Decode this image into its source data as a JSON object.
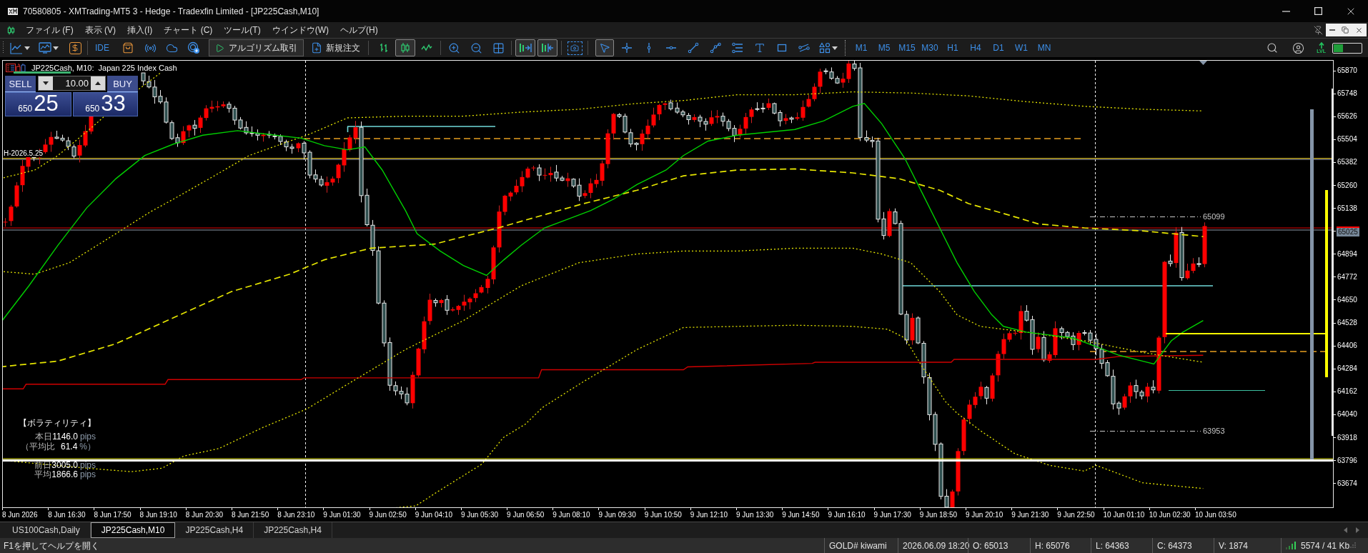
{
  "window": {
    "title": "70580805 - XMTrading-MT5 3 - Hedge - Tradexfin Limited - [JP225Cash,M10]"
  },
  "menu": [
    {
      "label": "ファイル (F)"
    },
    {
      "label": "表示 (V)"
    },
    {
      "label": "挿入(I)"
    },
    {
      "label": "チャート (C)"
    },
    {
      "label": "ツール(T)"
    },
    {
      "label": "ウインドウ(W)"
    },
    {
      "label": "ヘルプ(H)"
    }
  ],
  "toolbar": {
    "ide_label": "IDE",
    "algo_trading_label": "アルゴリズム取引",
    "new_order_label": "新規注文",
    "chart_types": [
      {
        "selected": false
      },
      {
        "selected": true
      },
      {
        "selected": false
      }
    ],
    "autoscroll": {
      "selected": true
    },
    "chart_shift": {
      "selected": true
    },
    "drawing_tools": [
      {
        "selected": true
      },
      {
        "selected": false
      },
      {
        "selected": false
      },
      {
        "selected": false
      },
      {
        "selected": false
      },
      {
        "selected": false
      },
      {
        "selected": false
      },
      {
        "selected": false
      },
      {
        "selected": false
      },
      {
        "selected": false
      },
      {
        "selected": false
      }
    ],
    "timeframes": [
      "M1",
      "M5",
      "M15",
      "M30",
      "H1",
      "H4",
      "D1",
      "W1",
      "MN"
    ],
    "level_label": "LVL",
    "meter": {
      "level": 0.33
    }
  },
  "chart": {
    "header": "JP225Cash, M10:  Japan 225 Index Cash",
    "one_click": {
      "sell_label": "SELL",
      "buy_label": "BUY",
      "volume": "10.00",
      "bid": {
        "prefix": "650",
        "main": "25"
      },
      "ask": {
        "prefix": "650",
        "main": "33"
      }
    },
    "h_line_label": "H-2026.5.25",
    "level_labels": [
      "65099",
      "63953"
    ],
    "volatility": {
      "title": "【ボラティリティ】",
      "rows": [
        {
          "label": "本日",
          "value": "1146.0",
          "unit": "pips"
        },
        {
          "label": "（平均比",
          "value": "61.4",
          "unit": "%）"
        },
        {
          "label": "前日",
          "value": "3005.0",
          "unit": "pips"
        },
        {
          "label": "平均",
          "value": "1866.6",
          "unit": "pips"
        }
      ]
    },
    "price_axis": [
      {
        "label": "65870",
        "current": false
      },
      {
        "label": "65748",
        "current": false
      },
      {
        "label": "65626",
        "current": false
      },
      {
        "label": "65504",
        "current": false
      },
      {
        "label": "65382",
        "current": false
      },
      {
        "label": "65260",
        "current": false
      },
      {
        "label": "65138",
        "current": false
      },
      {
        "label": "65025",
        "current": true
      },
      {
        "label": "64894",
        "current": false
      },
      {
        "label": "64772",
        "current": false
      },
      {
        "label": "64650",
        "current": false
      },
      {
        "label": "64528",
        "current": false
      },
      {
        "label": "64406",
        "current": false
      },
      {
        "label": "64284",
        "current": false
      },
      {
        "label": "64162",
        "current": false
      },
      {
        "label": "64040",
        "current": false
      },
      {
        "label": "63918",
        "current": false
      },
      {
        "label": "63796",
        "current": false
      },
      {
        "label": "63674",
        "current": false
      }
    ],
    "time_axis": [
      "8 Jun 2026",
      "8 Jun 16:30",
      "8 Jun 17:50",
      "8 Jun 19:10",
      "8 Jun 20:30",
      "8 Jun 21:50",
      "8 Jun 23:10",
      "9 Jun 01:30",
      "9 Jun 02:50",
      "9 Jun 04:10",
      "9 Jun 05:30",
      "9 Jun 06:50",
      "9 Jun 08:10",
      "9 Jun 09:30",
      "9 Jun 10:50",
      "9 Jun 12:10",
      "9 Jun 13:30",
      "9 Jun 14:50",
      "9 Jun 16:10",
      "9 Jun 17:30",
      "9 Jun 18:50",
      "9 Jun 20:10",
      "9 Jun 21:30",
      "9 Jun 22:50",
      "10 Jun 01:10",
      "10 Jun 02:30",
      "10 Jun 03:50"
    ]
  },
  "tabs": [
    {
      "label": "US100Cash,Daily",
      "selected": false
    },
    {
      "label": "JP225Cash,M10",
      "selected": true
    },
    {
      "label": "JP225Cash,H4",
      "selected": false
    },
    {
      "label": "JP225Cash,H4",
      "selected": false
    }
  ],
  "status_bar": {
    "help": "F1を押してヘルプを開く",
    "fields": [
      "GOLD# kiwami",
      "2026.06.09 18:20",
      "O: 65013",
      "H: 65076",
      "L: 64363",
      "C: 64373",
      "V: 1874"
    ],
    "traffic": "5574 / 41 Kb"
  }
}
